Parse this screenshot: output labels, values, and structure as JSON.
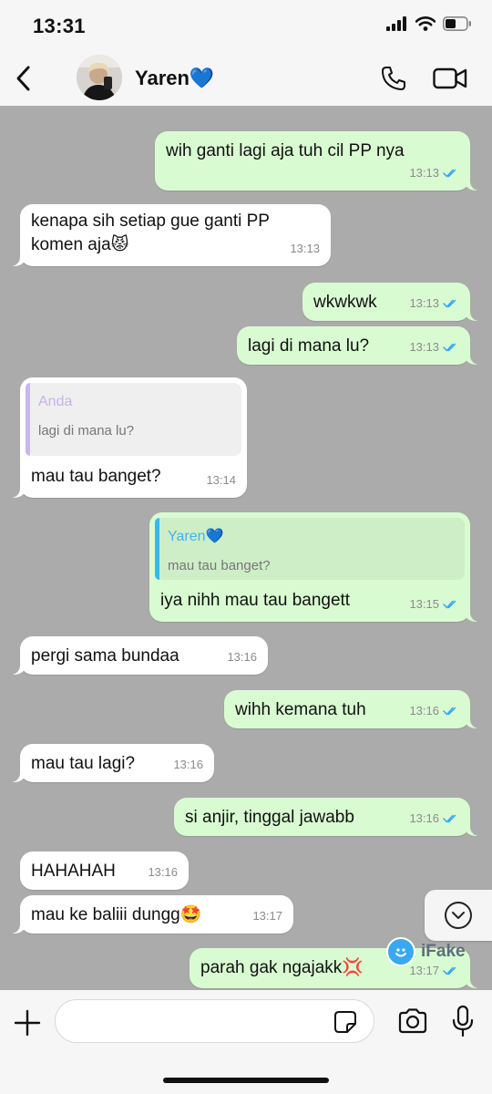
{
  "status_bar": {
    "time": "13:31"
  },
  "header": {
    "contact_name": "Yaren💙"
  },
  "messages": [
    {
      "dir": "out",
      "text": "wih ganti lagi aja tuh cil PP nya",
      "time": "13:13",
      "read": true
    },
    {
      "dir": "in",
      "text": "kenapa sih setiap gue ganti PP\nkomen aja😾",
      "time": "13:13"
    },
    {
      "dir": "out",
      "text": "wkwkwk",
      "time": "13:13",
      "read": true
    },
    {
      "dir": "out",
      "text": "lagi di mana lu?",
      "time": "13:13",
      "read": true
    },
    {
      "dir": "in",
      "quote_author": "Anda",
      "quote_text": "lagi di mana lu?",
      "text": "mau tau banget?",
      "time": "13:14"
    },
    {
      "dir": "out",
      "quote_author": "Yaren💙",
      "quote_text": "mau tau banget?",
      "text": "iya nihh mau tau bangett",
      "time": "13:15",
      "read": true
    },
    {
      "dir": "in",
      "text": "pergi sama bundaa",
      "time": "13:16"
    },
    {
      "dir": "out",
      "text": "wihh kemana tuh",
      "time": "13:16",
      "read": true
    },
    {
      "dir": "in",
      "text": "mau tau lagi?",
      "time": "13:16"
    },
    {
      "dir": "out",
      "text": "si anjir, tinggal jawabb",
      "time": "13:16",
      "read": true
    },
    {
      "dir": "in",
      "text": "HAHAHAH",
      "time": "13:16"
    },
    {
      "dir": "in",
      "text": "mau ke baliii dungg🤩",
      "time": "13:17"
    },
    {
      "dir": "out",
      "text": "parah gak ngajakk💢",
      "time": "13:17",
      "read": true
    }
  ],
  "watermark": {
    "text": "iFake"
  },
  "colors": {
    "chat_background": "#ababab",
    "outgoing_bubble": "#d9fbd2",
    "incoming_bubble": "#ffffff",
    "read_ticks": "#34a7f0",
    "quote_bar_in": "#c9b7ea",
    "quote_bar_out": "#36b8ef",
    "quote_author_in": "#c8b2e8",
    "quote_author_out": "#3fb4ec"
  },
  "icons": [
    "back-chevron-icon",
    "phone-icon",
    "video-camera-icon",
    "chevron-down-circle-icon",
    "plus-icon",
    "sticker-icon",
    "camera-icon",
    "microphone-icon"
  ]
}
